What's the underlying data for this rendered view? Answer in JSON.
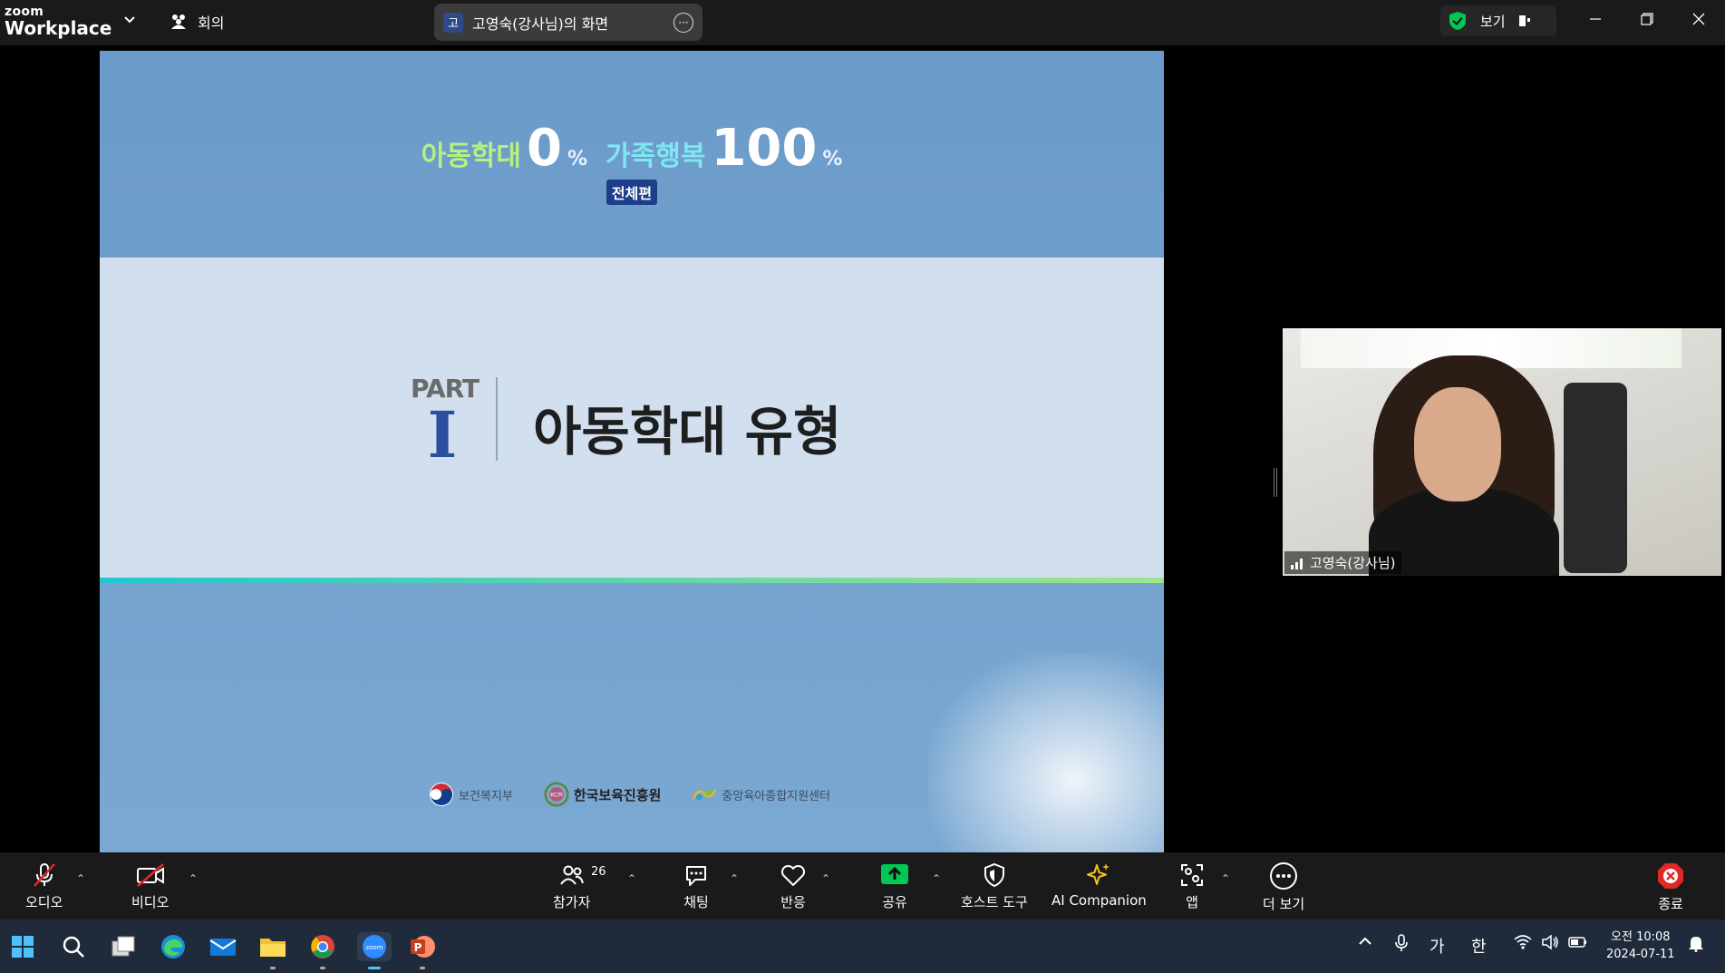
{
  "app": {
    "brand_small": "zoom",
    "brand_large": "Workplace",
    "meeting_label": "회의"
  },
  "share": {
    "avatar_initial": "고",
    "title": "고영숙(강사님)의 화면"
  },
  "view": {
    "label": "보기"
  },
  "slide": {
    "headline_a": "아동학대",
    "headline_a_value": "0",
    "headline_pct": "%",
    "headline_b": "가족행복",
    "headline_b_value": "100",
    "badge": "전체편",
    "part_label": "PART",
    "part_roman": "I",
    "title": "아동학대 유형",
    "logos": [
      "보건복지부",
      "한국보육진흥원",
      "중앙육아종합지원센터"
    ],
    "logo_abbrev": "KCPI"
  },
  "participant": {
    "name": "고영숙(강사님)"
  },
  "toolbar": {
    "audio": "오디오",
    "video": "비디오",
    "participants": "참가자",
    "participants_count": "26",
    "chat": "채팅",
    "reactions": "반응",
    "share": "공유",
    "host_tools": "호스트 도구",
    "ai_companion": "AI Companion",
    "apps": "앱",
    "more": "더 보기",
    "end": "종료"
  },
  "taskbar": {
    "ime_1": "가",
    "ime_2": "한",
    "clock_period": "오전 10:08",
    "clock_date": "2024-07-11",
    "zoom_icon_text": "zoom",
    "ppt_icon_text": "P"
  },
  "colors": {
    "accent_green": "#00c853",
    "end_red": "#e02828",
    "slide_blue": "#6b9bc9"
  }
}
